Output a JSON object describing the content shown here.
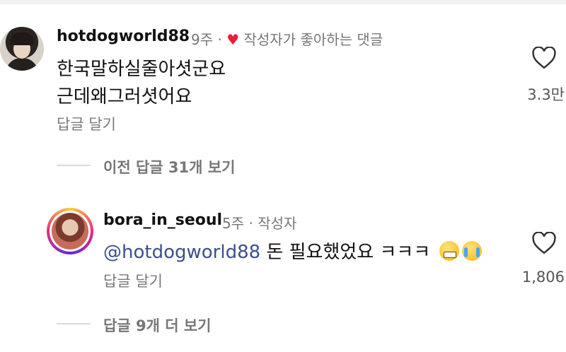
{
  "comment1": {
    "username": "hotdogworld88",
    "time": "9주",
    "separator": "·",
    "creator_like_label": "작성자가 좋아하는 댓글",
    "text_line1": "한국말하실줄아셧군요",
    "text_line2": "근데왜그러셧어요",
    "reply_label": "답글 달기",
    "like_count": "3.3만"
  },
  "thread": {
    "view_previous_label": "이전 답글 31개 보기"
  },
  "comment2": {
    "username": "bora_in_seoul",
    "time": "5주",
    "separator": "·",
    "author_label": "작성자",
    "mention": "@hotdogworld88",
    "text": " 돈 필요했었요 ㅋㅋㅋ ",
    "emojis": [
      "grinning-face-emoji",
      "loudly-crying-face-emoji"
    ],
    "reply_label": "답글 달기",
    "like_count": "1,806"
  },
  "more_replies": {
    "label": "답글 9개 더 보기"
  },
  "colors": {
    "creator_heart": "#ed1c3c",
    "mention": "#3b4f8f",
    "secondary_text": "#777777"
  }
}
